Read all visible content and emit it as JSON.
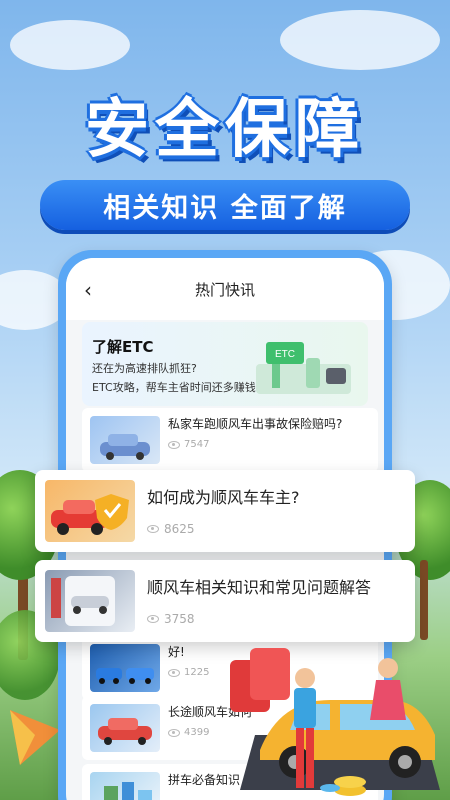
{
  "hero": {
    "title": "安全保障",
    "subtitle": "相关知识 全面了解"
  },
  "app": {
    "back_icon": "chevron-left-icon",
    "title": "热门快讯"
  },
  "etc_banner": {
    "heading": "了解ETC",
    "line1": "还在为高速排队抓狂?",
    "line2": "ETC攻略，帮车主省时间还多赚钱!",
    "badge": "ETC"
  },
  "list": [
    {
      "title": "私家车跑顺风车出事故保险赔吗?",
      "views": "7547"
    },
    {
      "title": "好!",
      "views": "1225"
    },
    {
      "title": "长途顺风车如何",
      "views": "4399"
    },
    {
      "title": "拼车必备知识 ... 原来拼车注意这些!",
      "views": ""
    }
  ],
  "popups": [
    {
      "title": "如何成为顺风车车主?",
      "views": "8625"
    },
    {
      "title": "顺风车相关知识和常见问题解答",
      "views": "3758"
    }
  ],
  "colors": {
    "brand_blue": "#1f6fe0",
    "phone_frame": "#5aa7f5",
    "pill_blue": "#1560e0"
  }
}
